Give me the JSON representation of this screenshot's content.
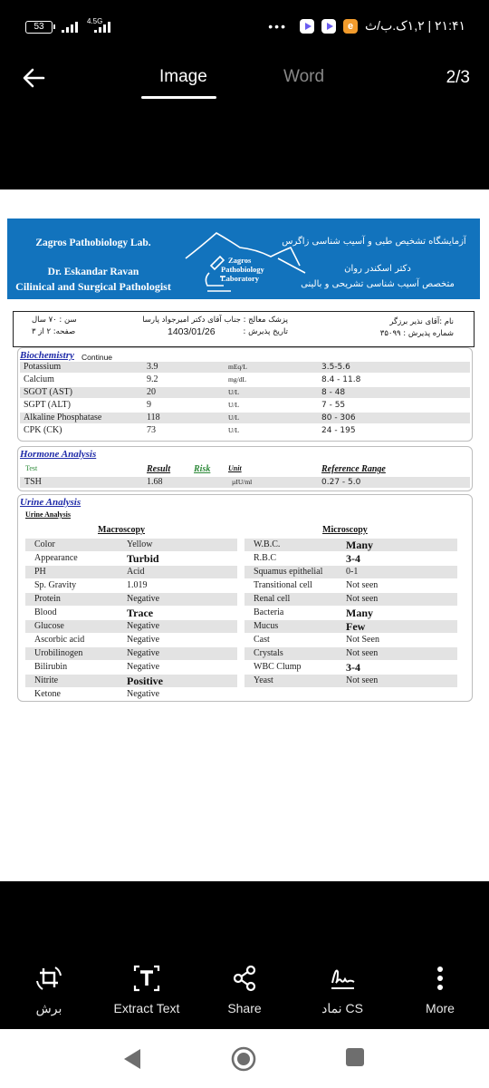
{
  "status_bar": {
    "battery": "53",
    "network": "4.5G",
    "time_text": "۲۱:۴۱ | ۱,۲ک.ب/ث",
    "more_dots": "•••",
    "app_icon_orange": "e"
  },
  "app_bar": {
    "tabs": [
      {
        "label": "Image",
        "active": true
      },
      {
        "label": "Word",
        "active": false
      }
    ],
    "page_counter": "2/3"
  },
  "document": {
    "lab_header": {
      "en_title": "Zagros Pathobiology Lab.",
      "en_doctor": "Dr. Eskandar Ravan",
      "en_specialty": "Cilinical and Surgical Pathologist",
      "logo_lines": [
        "Zagros",
        "Pathobiology",
        "Laboratory"
      ],
      "fa_title": "آزمایشگاه تشخیص طبی و آسیب شناسی زاگرس",
      "fa_doctor": "دکتر اسکندر روان",
      "fa_specialty": "متخصص آسیب شناسی تشریحی و بالینی"
    },
    "patient": {
      "name": "نام :آقای نذیر برزگر",
      "admission_no": "شماره پذیرش :  ۳۵۰۹۹",
      "physician": "پزشک معالج : جناب آقای دکتر امیرجواد پارسا",
      "admission_date_label": "تاریخ پذیرش :",
      "admission_date": "1403/01/26",
      "age": "سن :    ۷۰ سال",
      "page": "صفحه: ۲  از  ۳"
    },
    "biochemistry": {
      "title": "Biochemistry",
      "subtitle": "Continue",
      "rows": [
        {
          "test": "Potassium",
          "result": "3.9",
          "unit": "mEq/L",
          "range": "3.5-5.6"
        },
        {
          "test": "Calcium",
          "result": "9.2",
          "unit": "mg/dL",
          "range": "8.4 - 11.8"
        },
        {
          "test": "SGOT (AST)",
          "result": "20",
          "unit": "U/L",
          "range": "8 - 48"
        },
        {
          "test": "SGPT (ALT)",
          "result": "9",
          "unit": "U/L",
          "range": "7 - 55"
        },
        {
          "test": "Alkaline Phosphatase",
          "result": "118",
          "unit": "U/L",
          "range": "80 - 306"
        },
        {
          "test": "CPK (CK)",
          "result": "73",
          "unit": "U/L",
          "range": "24 - 195"
        }
      ]
    },
    "hormone": {
      "title": "Hormone Analysis",
      "headers": {
        "test": "Test",
        "result": "Result",
        "risk": "Risk",
        "unit": "Unit",
        "range": "Reference Range"
      },
      "rows": [
        {
          "test": "TSH",
          "result": "1.68",
          "risk": "",
          "unit": "µIU/ml",
          "range": "0.27 - 5.0"
        }
      ]
    },
    "urine": {
      "title": "Urine Analysis",
      "subtitle": "Urine Analysis",
      "macroscopy_title": "Macroscopy",
      "microscopy_title": "Microscopy",
      "macroscopy": [
        {
          "test": "Color",
          "result": "Yellow",
          "bold": false
        },
        {
          "test": "Appearance",
          "result": "Turbid",
          "bold": true
        },
        {
          "test": "PH",
          "result": "Acid",
          "bold": false
        },
        {
          "test": "Sp. Gravity",
          "result": "1.019",
          "bold": false
        },
        {
          "test": "Protein",
          "result": "Negative",
          "bold": false
        },
        {
          "test": "Blood",
          "result": "Trace",
          "bold": true
        },
        {
          "test": "Glucose",
          "result": "Negative",
          "bold": false
        },
        {
          "test": "Ascorbic acid",
          "result": "Negative",
          "bold": false
        },
        {
          "test": "Urobilinogen",
          "result": "Negative",
          "bold": false
        },
        {
          "test": "Bilirubin",
          "result": "Negative",
          "bold": false
        },
        {
          "test": "Nitrite",
          "result": "Positive",
          "bold": true
        },
        {
          "test": "Ketone",
          "result": "Negative",
          "bold": false
        }
      ],
      "microscopy": [
        {
          "test": "W.B.C.",
          "result": "Many",
          "bold": true
        },
        {
          "test": "R.B.C",
          "result": "3-4",
          "bold": true
        },
        {
          "test": "Squamus epithelial",
          "result": "0-1",
          "bold": false
        },
        {
          "test": "Transitional cell",
          "result": "Not seen",
          "bold": false
        },
        {
          "test": "Renal cell",
          "result": "Not seen",
          "bold": false
        },
        {
          "test": "Bacteria",
          "result": "Many",
          "bold": true
        },
        {
          "test": "Mucus",
          "result": "Few",
          "bold": true
        },
        {
          "test": "Cast",
          "result": "Not Seen",
          "bold": false
        },
        {
          "test": "Crystals",
          "result": "Not seen",
          "bold": false
        },
        {
          "test": "WBC Clump",
          "result": "3-4",
          "bold": true
        },
        {
          "test": "Yeast",
          "result": "Not seen",
          "bold": false
        }
      ]
    }
  },
  "toolbar": {
    "items": [
      {
        "label": "برش",
        "icon": "crop-icon"
      },
      {
        "label": "Extract Text",
        "icon": "extract-text-icon"
      },
      {
        "label": "Share",
        "icon": "share-icon"
      },
      {
        "label": "نماد CS",
        "icon": "signature-icon"
      },
      {
        "label": "More",
        "icon": "more-vertical-icon"
      }
    ]
  },
  "colors": {
    "lab_header_bg": "#1273bd",
    "section_title": "#1e2aa8",
    "risk_green": "#2e8a3a",
    "row_shade": "#e3e3e3"
  }
}
